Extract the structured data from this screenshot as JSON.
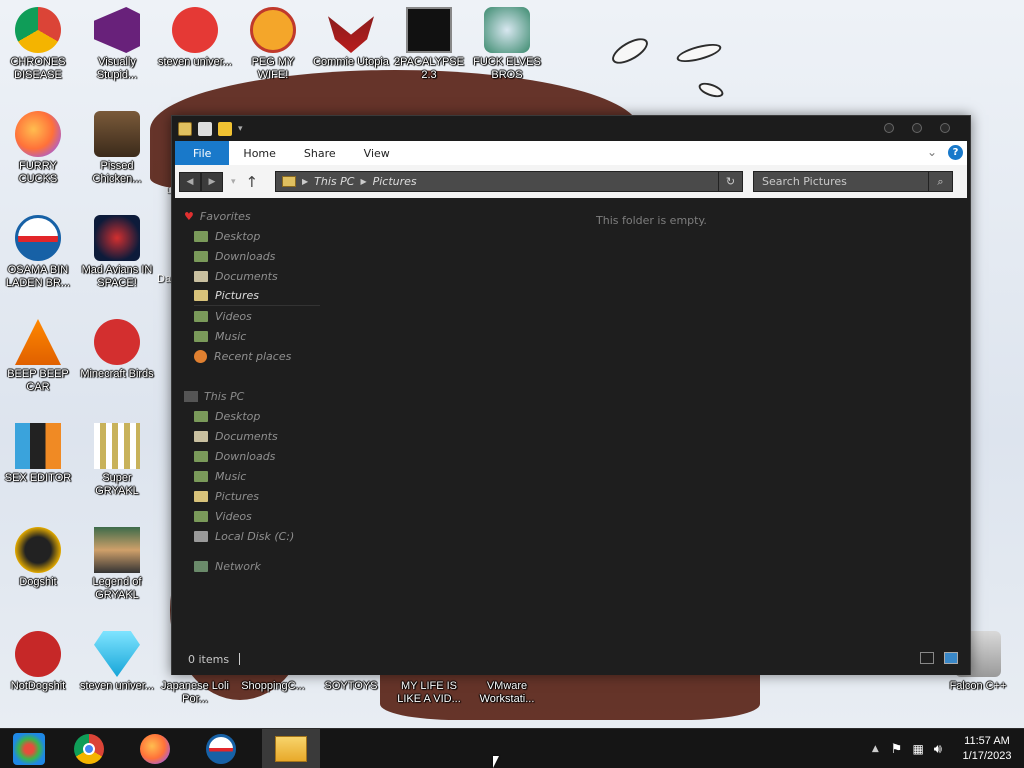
{
  "desktop": {
    "icons": [
      {
        "label": "CHRONES DISEASE",
        "icon": "chrome-icon"
      },
      {
        "label": "Visually Stupid...",
        "icon": "visual-studio-icon"
      },
      {
        "label": "steven univer...",
        "icon": "steven-universe-icon"
      },
      {
        "label": "PEG MY WIFE!",
        "icon": "p-logo-icon"
      },
      {
        "label": "Commie Utopia",
        "icon": "eagle-icon"
      },
      {
        "label": "2PACALYPSE 2.3",
        "icon": "console-icon"
      },
      {
        "label": "FUCK ELVES BROS",
        "icon": "elf-game-icon"
      },
      {
        "label": "FURRY CUCKS",
        "icon": "firefox-icon"
      },
      {
        "label": "Pissed Chicken...",
        "icon": "angry-birds-seasons-icon"
      },
      {
        "label": "OSAMA BIN LADEN BR...",
        "icon": "obama-logo-icon"
      },
      {
        "label": "Mad Avians IN SPACE!",
        "icon": "angry-birds-space-icon"
      },
      {
        "label": "BEEP BEEP CAR",
        "icon": "vlc-icon"
      },
      {
        "label": "Minecraft Birds",
        "icon": "angry-bird-icon"
      },
      {
        "label": "SEX EDITOR",
        "icon": "hxd-icon"
      },
      {
        "label": "Super GRYAKL",
        "icon": "pixel-character-icon"
      },
      {
        "label": "Dogshit",
        "icon": "c-plus-plus-icon"
      },
      {
        "label": "Legend of GRYAKL",
        "icon": "pixel-hero-icon"
      },
      {
        "label": "NotDogshit",
        "icon": "dev-cpp-icon"
      },
      {
        "label": "steven univer...",
        "icon": "diamond-icon"
      },
      {
        "label": "Japanese Loli Por...",
        "icon": "generic-icon"
      },
      {
        "label": "ShoppingC...",
        "icon": "generic-icon"
      },
      {
        "label": "SOYTOYS",
        "icon": "generic-icon"
      },
      {
        "label": "MY LIFE IS LIKE A VID...",
        "icon": "generic-icon"
      },
      {
        "label": "VMware Workstati...",
        "icon": "vmware-icon"
      },
      {
        "label": "Falcon C++",
        "icon": "recycle-bin-icon"
      }
    ],
    "partial_labels": [
      "Da",
      "u"
    ]
  },
  "explorer": {
    "ribbon_tabs": [
      "File",
      "Home",
      "Share",
      "View"
    ],
    "address": {
      "segments": [
        "This PC",
        "Pictures"
      ]
    },
    "search_placeholder": "Search Pictures",
    "empty_message": "This folder is empty.",
    "status": "0 items",
    "nav": {
      "favorites_header": "Favorites",
      "favorites": [
        "Desktop",
        "Downloads",
        "Documents",
        "Pictures",
        "Videos",
        "Music",
        "Recent places"
      ],
      "selected": "Pictures",
      "thispc_header": "This PC",
      "thispc": [
        "Desktop",
        "Documents",
        "Downloads",
        "Music",
        "Pictures",
        "Videos",
        "Local Disk (C:)"
      ],
      "network": "Network"
    }
  },
  "taskbar": {
    "apps": [
      "chrome-icon",
      "firefox-icon",
      "obama-logo-icon",
      "file-explorer-icon"
    ],
    "time": "11:57 AM",
    "date": "1/17/2023"
  }
}
